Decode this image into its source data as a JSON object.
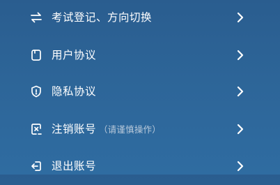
{
  "menu": {
    "items": [
      {
        "label": "考试登记、方向切换",
        "hint": "",
        "icon": "swap-arrows-icon"
      },
      {
        "label": "用户协议",
        "hint": "",
        "icon": "document-icon"
      },
      {
        "label": "隐私协议",
        "hint": "",
        "icon": "shield-icon"
      },
      {
        "label": "注销账号",
        "hint": "（请谨慎操作）",
        "icon": "cancel-account-icon"
      },
      {
        "label": "退出账号",
        "hint": "",
        "icon": "logout-icon"
      }
    ],
    "chevron_icon": "chevron-right-icon"
  },
  "colors": {
    "background_top": "#2a5d8f",
    "background_bottom": "#2f6ca1",
    "text": "#ffffff",
    "hint_text": "#b9c9da"
  }
}
